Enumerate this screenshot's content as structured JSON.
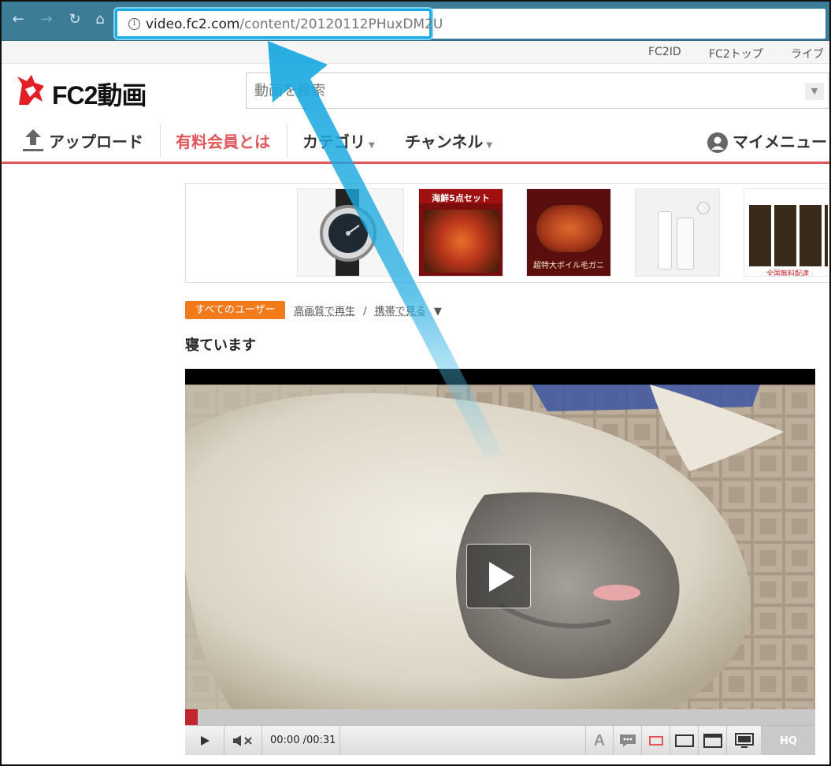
{
  "browser": {
    "url_host": "video.fc2.com",
    "url_path": "/content/20120112PHuxDM2U"
  },
  "toplinks": [
    "FC2ID",
    "FC2トップ",
    "ライブ"
  ],
  "header": {
    "logo_text": "FC2動画",
    "search_placeholder": "動画を検索"
  },
  "nav": {
    "upload": "アップロード",
    "premium": "有料会員とは",
    "category": "カテゴリ",
    "channel": "チャンネル",
    "mymenu": "マイメニュー"
  },
  "ads": [
    {
      "label": ""
    },
    {
      "label": "海鮮5点セット"
    },
    {
      "label": "超特大ボイル毛ガニ"
    },
    {
      "label": ""
    },
    {
      "label": "全国無料配達"
    }
  ],
  "video_info": {
    "audience_tag": "すべてのユーザー",
    "hq_link": "高画質で再生",
    "separator": "/",
    "mobile_link": "携帯で見る",
    "dropdown": "▼",
    "title": "寝ています"
  },
  "player": {
    "time_current": "00:00",
    "time_total": "/00:31",
    "hq_label": "HQ",
    "progress_fraction": 0.02
  },
  "colors": {
    "brand_red": "#e0565b",
    "tag_orange": "#f27a1a",
    "highlight_blue": "#1aa9e0"
  }
}
